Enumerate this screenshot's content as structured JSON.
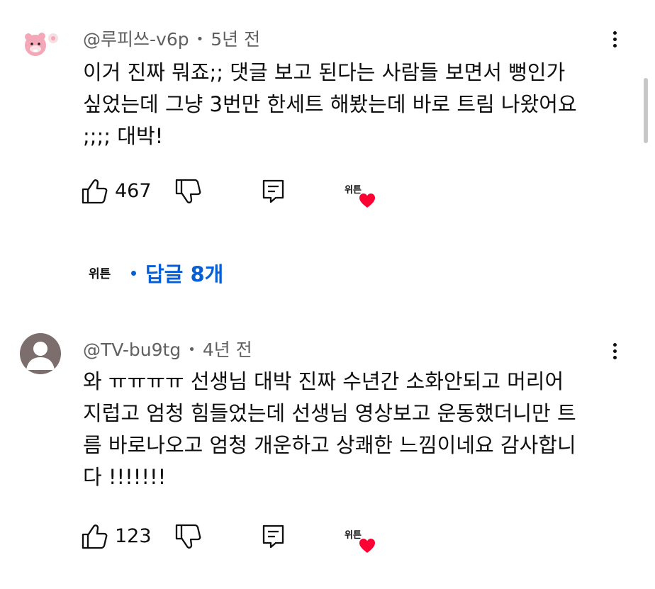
{
  "comments": [
    {
      "author": "@루피쓰-v6p",
      "time": "5년 전",
      "text": "이거 진짜 뭐죠;; 댓글 보고 된다는 사람들 보면서 뻥인가\n싶었는데 그냥 3번만 한세트 해봤는데 바로 트림 나왔어요\n;;;; 대박!",
      "likes": "467",
      "creator_badge": "위튼",
      "replies": {
        "creator_avatar_text": "위튼",
        "label": "답글 8개"
      }
    },
    {
      "author": "@TV-bu9tg",
      "time": "4년 전",
      "text": "와 ㅠㅠㅠㅠ 선생님 대박 진짜 수년간 소화안되고 머리어\n지럽고 엄청 힘들었는데 선생님 영상보고 운동했더니만 트\n름 바로나오고 엄청 개운하고 상쾌한 느낌이네요 감사합니\n다 !!!!!!!",
      "likes": "123",
      "creator_badge": "위튼"
    }
  ],
  "icons": {
    "like": "thumbs-up-icon",
    "dislike": "thumbs-down-icon",
    "reply": "reply-icon",
    "more": "more-vert-icon",
    "heart": "heart-icon"
  },
  "colors": {
    "link": "#065fd4",
    "heart": "#ff0033",
    "meta": "#606060"
  }
}
